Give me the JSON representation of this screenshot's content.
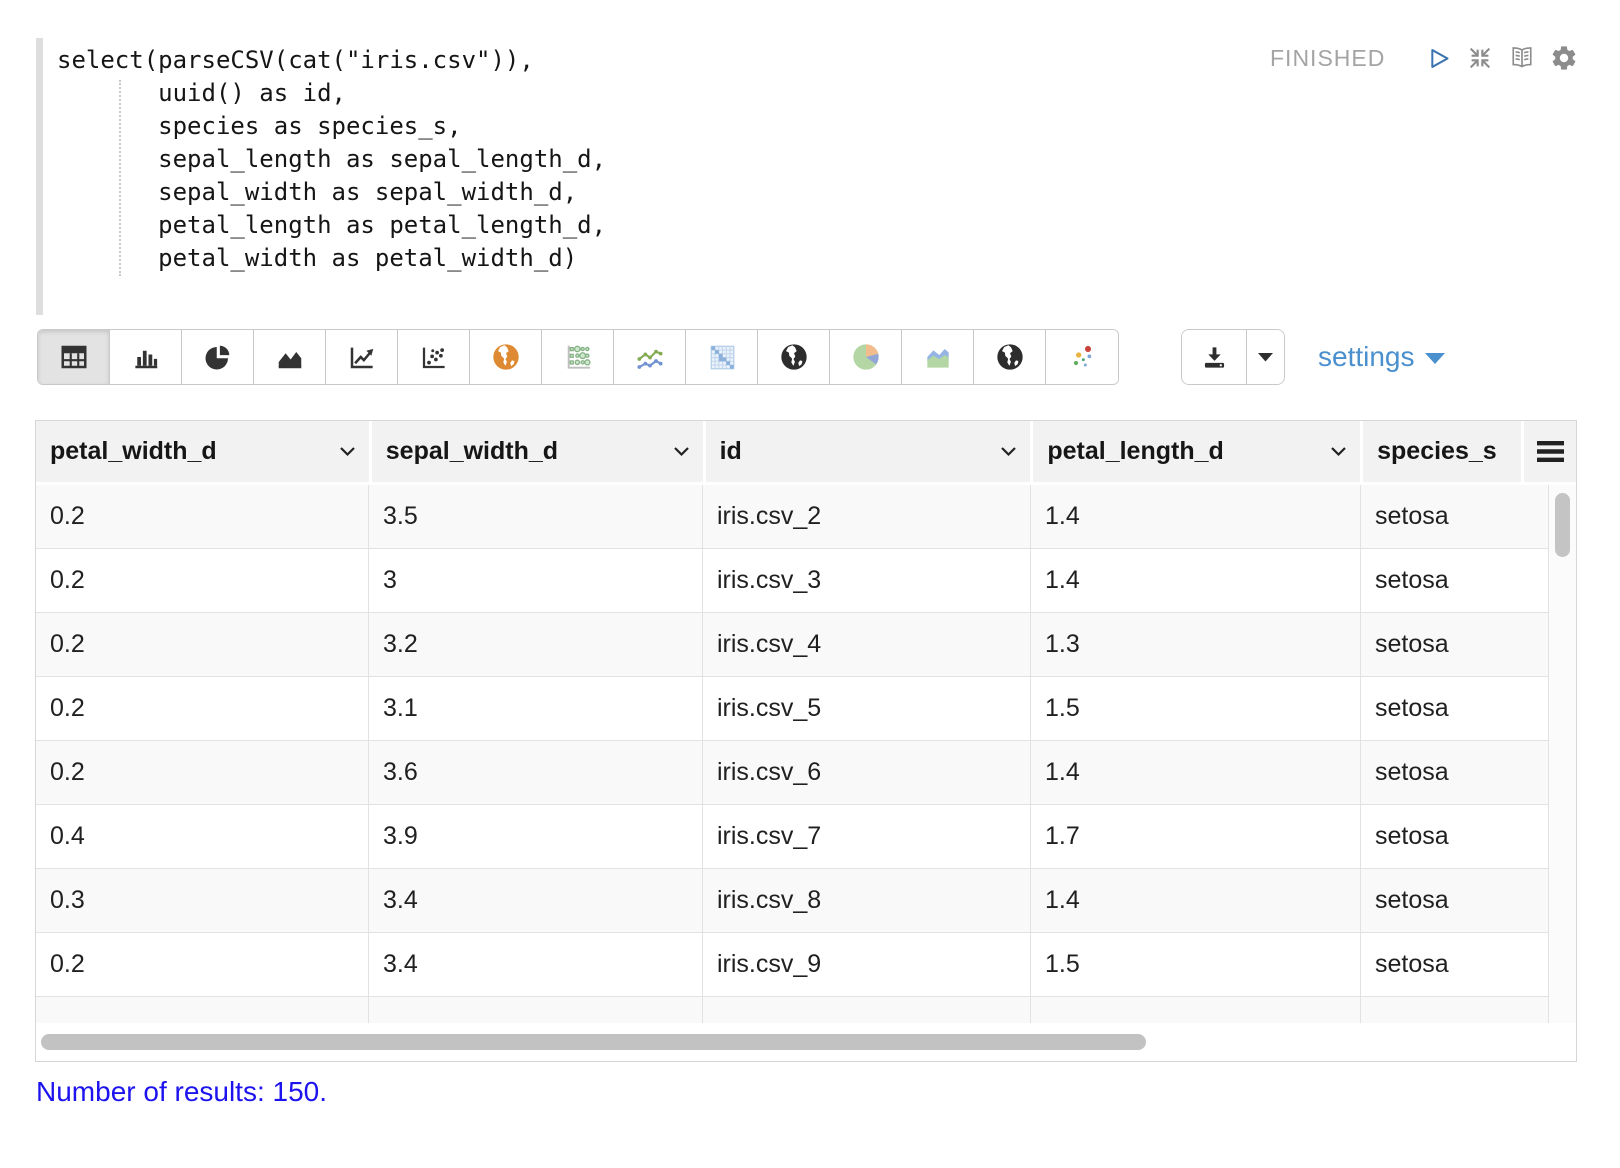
{
  "paragraph": {
    "code": {
      "lines": [
        "select(parseCSV(cat(\"iris.csv\")),",
        "       uuid() as id,",
        "       species as species_s,",
        "       sepal_length as sepal_length_d,",
        "       sepal_width as sepal_width_d,",
        "       petal_length as petal_length_d,",
        "       petal_width as petal_width_d)"
      ]
    },
    "status": {
      "label": "FINISHED"
    },
    "control_icons": [
      "play-icon",
      "compress-icon",
      "book-icon",
      "gear-icon"
    ]
  },
  "viz_toolbar": {
    "buttons": [
      "table",
      "bar-chart",
      "pie-chart",
      "area-chart",
      "line-chart",
      "scatter-chart",
      "globe-orange",
      "bubble-matrix",
      "multi-line-chart",
      "heatmap-grid",
      "globe-dark",
      "pie-colored",
      "area-colored",
      "globe-dark-2",
      "scatter-colored"
    ],
    "active_button": "table",
    "download": {
      "icons": [
        "download-icon",
        "caret-down-icon"
      ]
    },
    "settings_label": "settings"
  },
  "table": {
    "columns": [
      {
        "label": "petal_width_d"
      },
      {
        "label": "sepal_width_d"
      },
      {
        "label": "id"
      },
      {
        "label": "petal_length_d"
      },
      {
        "label": "species_s"
      }
    ],
    "rows": [
      [
        "0.2",
        "3.5",
        "iris.csv_2",
        "1.4",
        "setosa"
      ],
      [
        "0.2",
        "3",
        "iris.csv_3",
        "1.4",
        "setosa"
      ],
      [
        "0.2",
        "3.2",
        "iris.csv_4",
        "1.3",
        "setosa"
      ],
      [
        "0.2",
        "3.1",
        "iris.csv_5",
        "1.5",
        "setosa"
      ],
      [
        "0.2",
        "3.6",
        "iris.csv_6",
        "1.4",
        "setosa"
      ],
      [
        "0.4",
        "3.9",
        "iris.csv_7",
        "1.7",
        "setosa"
      ],
      [
        "0.3",
        "3.4",
        "iris.csv_8",
        "1.4",
        "setosa"
      ],
      [
        "0.2",
        "3.4",
        "iris.csv_9",
        "1.5",
        "setosa"
      ]
    ]
  },
  "footer": {
    "results_text": "Number of results: 150."
  },
  "colors": {
    "settings_blue": "#4a8fce",
    "results_link_blue": "#1c13ef",
    "status_gray": "#a4a4a4",
    "play_blue": "#3b74b0",
    "header_bg": "#f2f2f2",
    "row_stripe": "#f9f9f9"
  }
}
